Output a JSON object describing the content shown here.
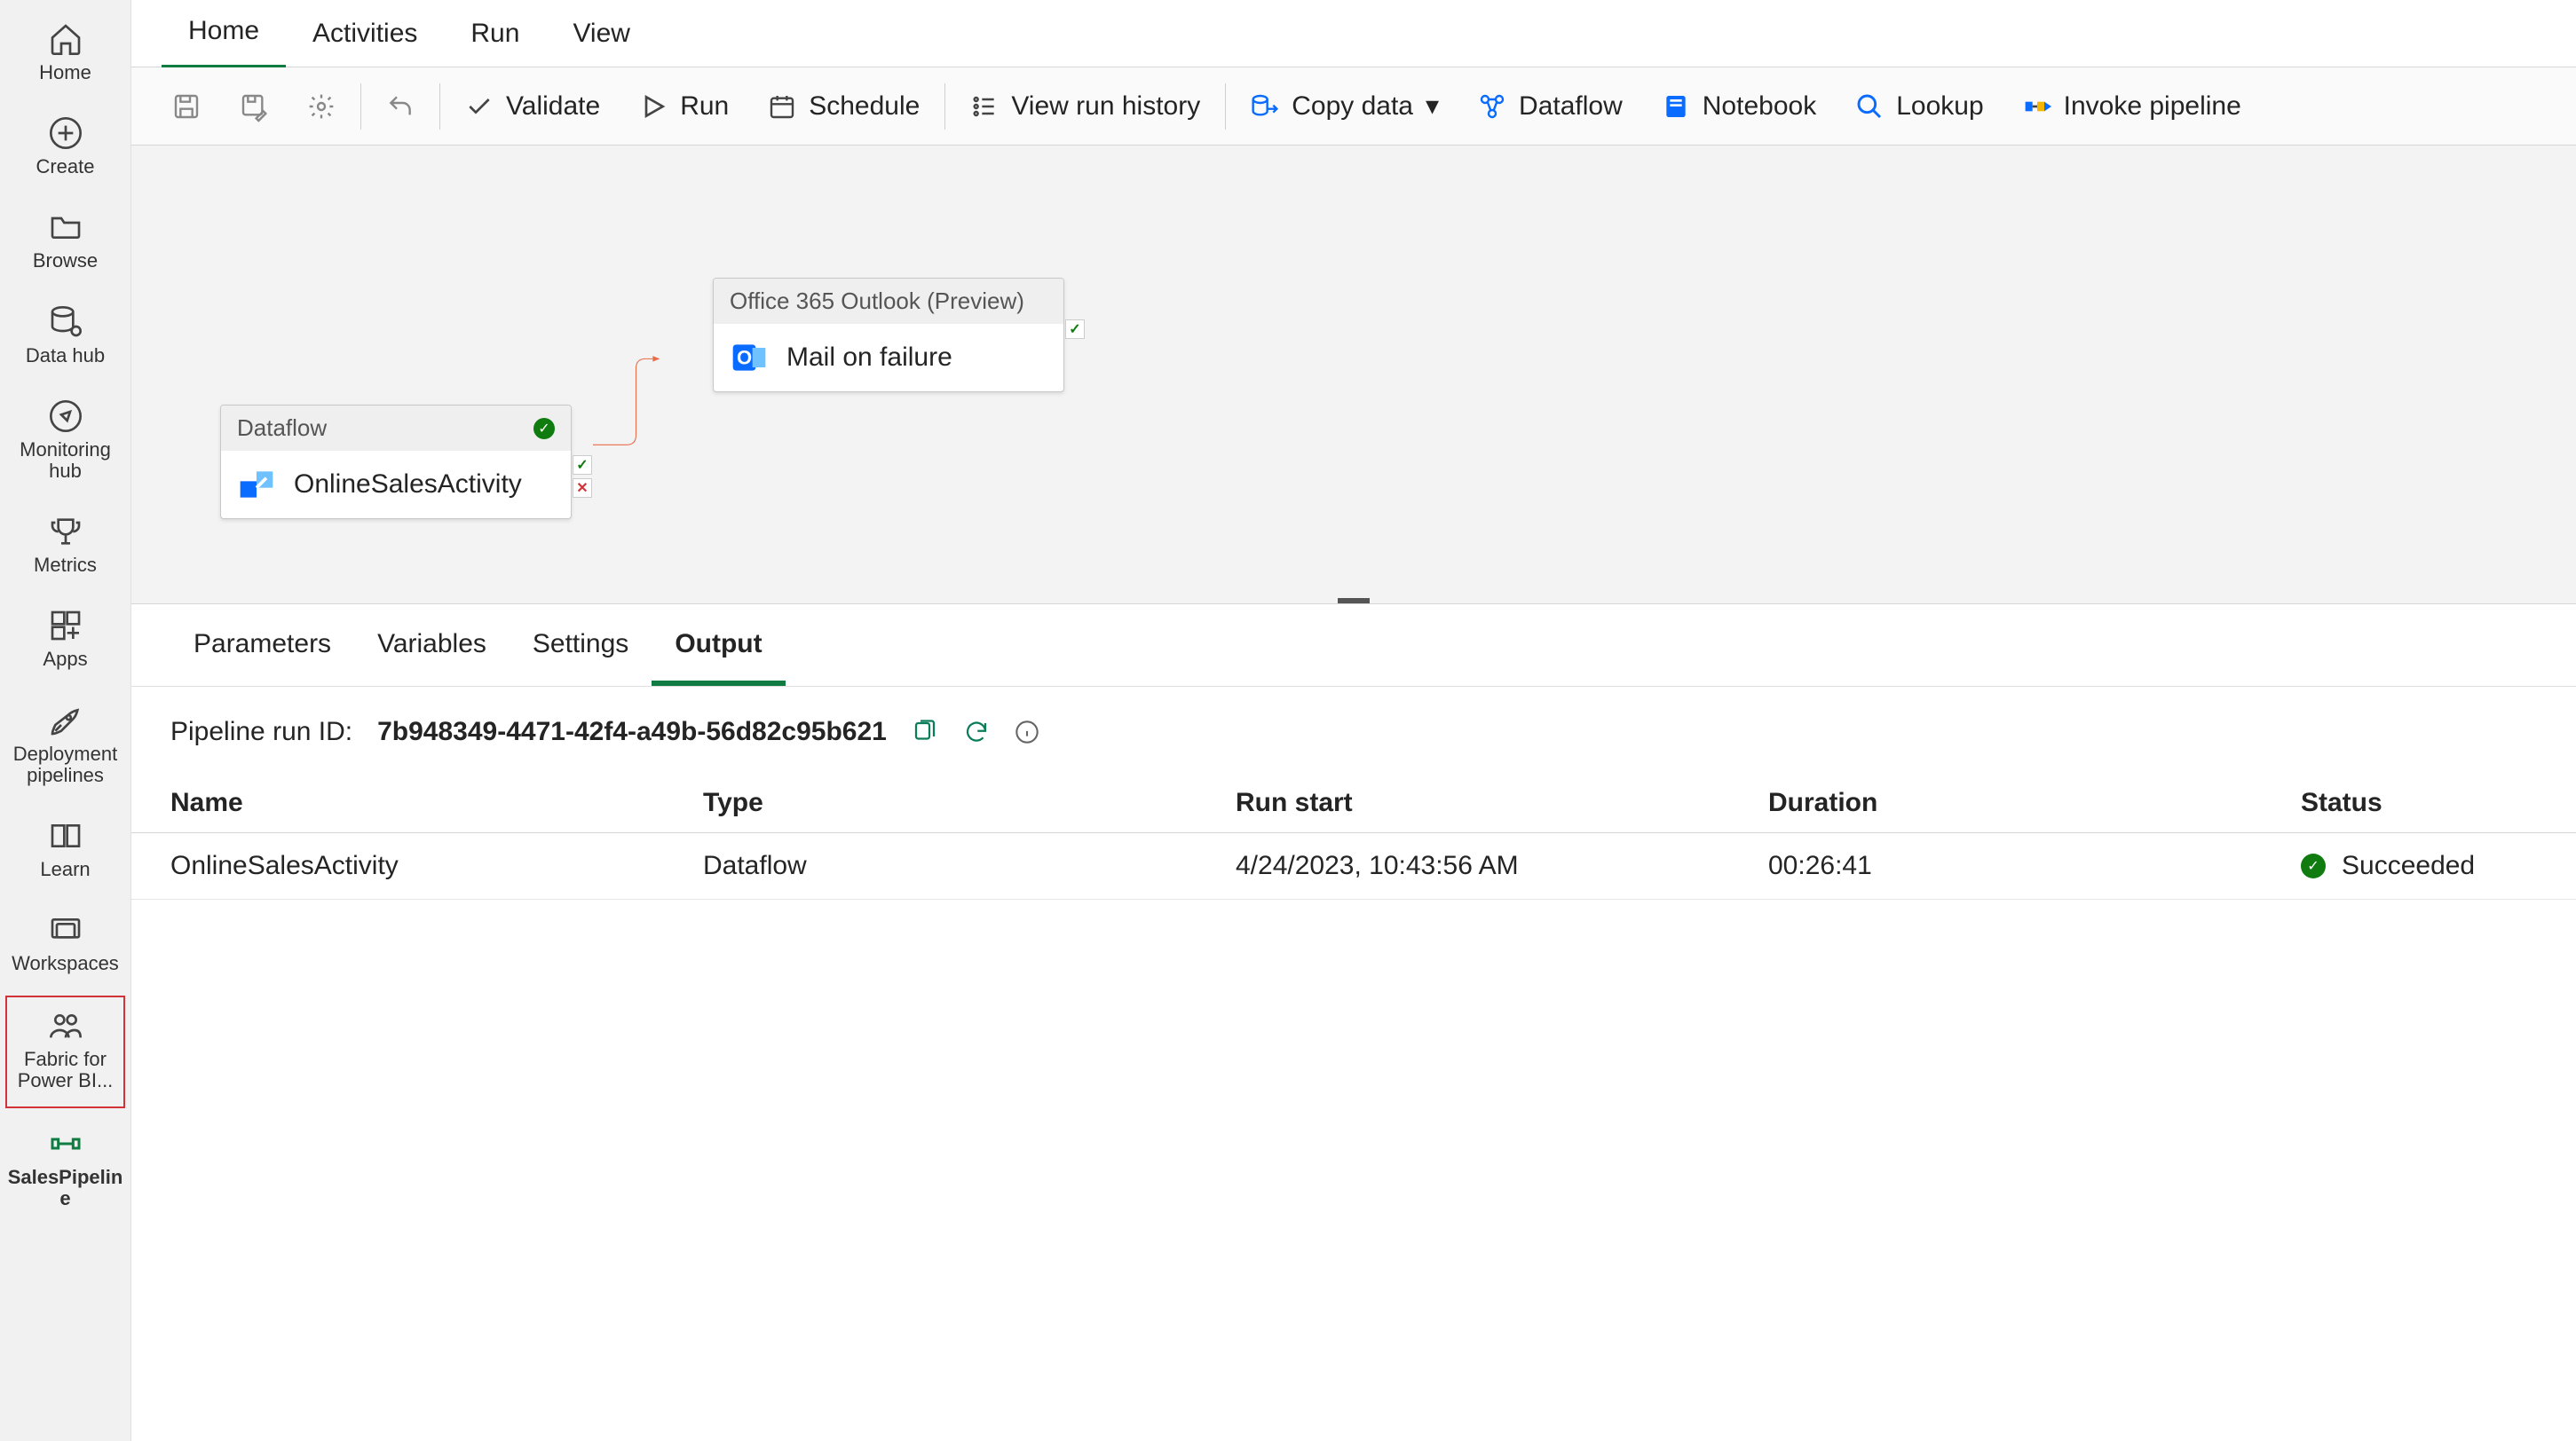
{
  "rail": {
    "home": "Home",
    "create": "Create",
    "browse": "Browse",
    "datahub": "Data hub",
    "monitoring": "Monitoring hub",
    "metrics": "Metrics",
    "apps": "Apps",
    "deployment": "Deployment pipelines",
    "learn": "Learn",
    "workspaces": "Workspaces",
    "fabric": "Fabric for Power BI...",
    "pipeline": "SalesPipelin e"
  },
  "tabs": [
    "Home",
    "Activities",
    "Run",
    "View"
  ],
  "ribbon": {
    "validate": "Validate",
    "run": "Run",
    "schedule": "Schedule",
    "view_history": "View run history",
    "copy_data": "Copy data",
    "dataflow": "Dataflow",
    "notebook": "Notebook",
    "lookup": "Lookup",
    "invoke": "Invoke pipeline"
  },
  "canvas": {
    "activity1": {
      "type": "Dataflow",
      "name": "OnlineSalesActivity"
    },
    "activity2": {
      "type": "Office 365 Outlook (Preview)",
      "name": "Mail on failure"
    }
  },
  "detail_tabs": [
    "Parameters",
    "Variables",
    "Settings",
    "Output"
  ],
  "runid_label": "Pipeline run ID:",
  "runid": "7b948349-4471-42f4-a49b-56d82c95b621",
  "output": {
    "headers": [
      "Name",
      "Type",
      "Run start",
      "Duration",
      "Status"
    ],
    "row": {
      "name": "OnlineSalesActivity",
      "type": "Dataflow",
      "start": "4/24/2023, 10:43:56 AM",
      "duration": "00:26:41",
      "status": "Succeeded"
    }
  }
}
